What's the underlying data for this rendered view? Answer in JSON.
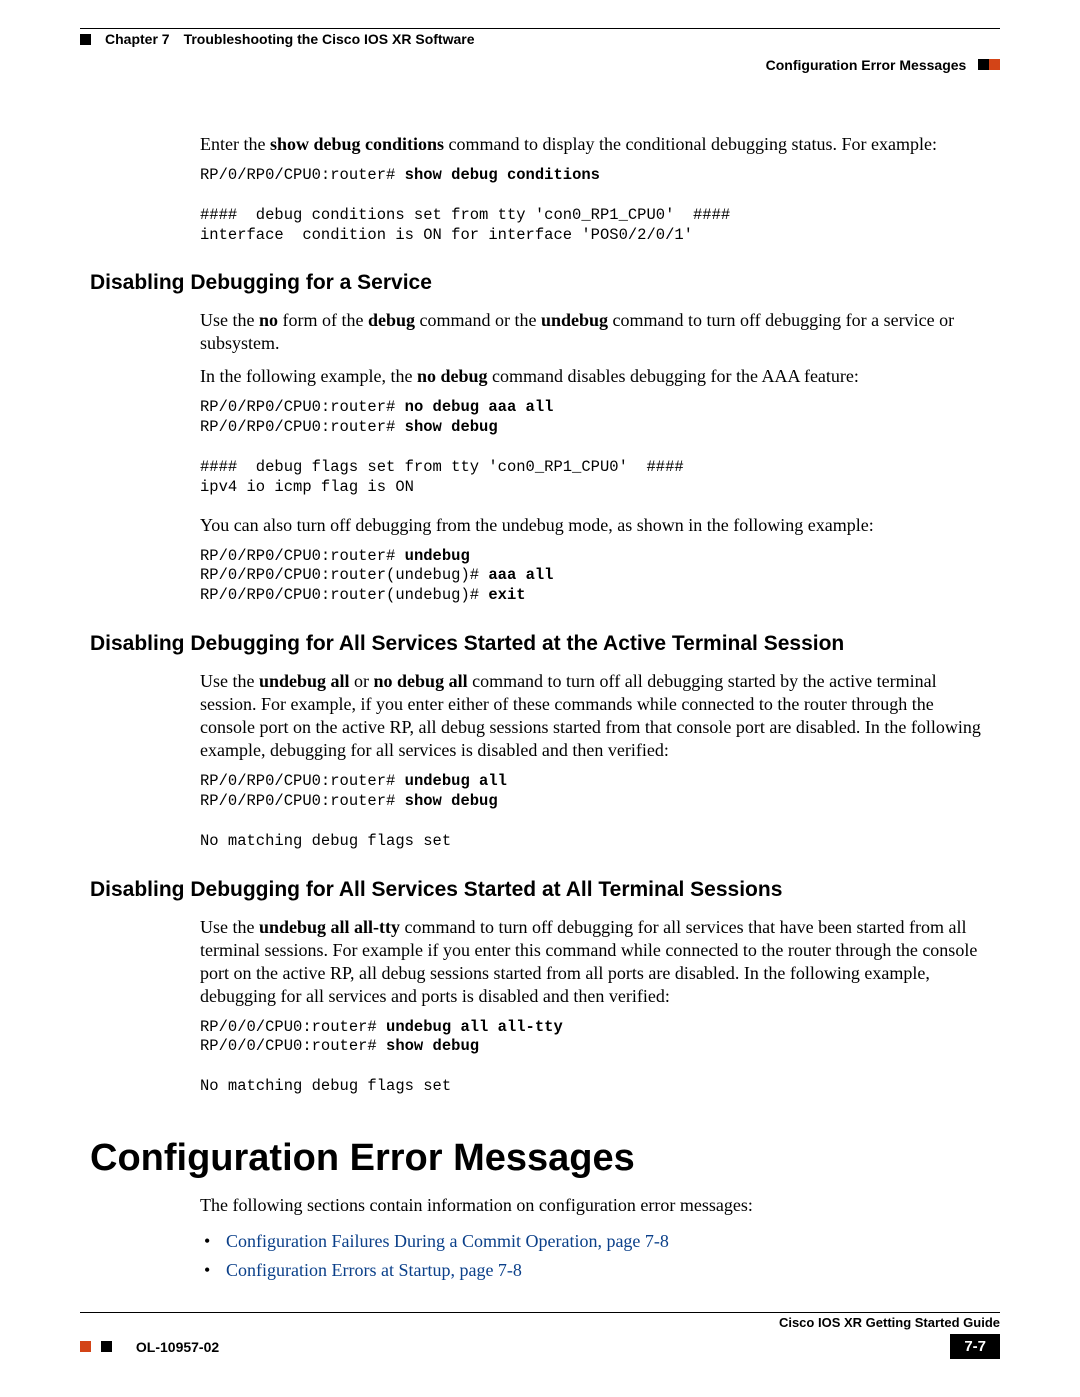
{
  "header": {
    "chapter_label": "Chapter 7",
    "chapter_title": "Troubleshooting the Cisco IOS XR Software",
    "section_label": "Configuration Error Messages"
  },
  "intro": {
    "pre": "Enter the ",
    "bold": "show debug conditions",
    "post": " command to display the conditional debugging status. For example:"
  },
  "code1": {
    "l1p": "RP/0/RP0/CPU0:router# ",
    "l1b": "show debug conditions",
    "l2": "",
    "l3": "####  debug conditions set from tty 'con0_RP1_CPU0'  ####",
    "l4": "interface  condition is ON for interface 'POS0/2/0/1'"
  },
  "s1": {
    "title": "Disabling Debugging for a Service",
    "p1_a": "Use the ",
    "p1_b_no": "no",
    "p1_c": " form of the ",
    "p1_b_debug": "debug",
    "p1_d": " command or the ",
    "p1_b_undebug": "undebug",
    "p1_e": " command to turn off debugging for a service or subsystem.",
    "p2_a": "In the following example, the ",
    "p2_b": "no debug",
    "p2_c": " command disables debugging for the AAA feature:",
    "code": {
      "l1p": "RP/0/RP0/CPU0:router# ",
      "l1b": "no debug aaa all",
      "l2p": "RP/0/RP0/CPU0:router# ",
      "l2b": "show debug",
      "l3": "",
      "l4": "####  debug flags set from tty 'con0_RP1_CPU0'  ####",
      "l5": "ipv4 io icmp flag is ON"
    },
    "p3": "You can also turn off debugging from the undebug mode, as shown in the following example:",
    "code2": {
      "l1p": "RP/0/RP0/CPU0:router# ",
      "l1b": "undebug",
      "l2p": "RP/0/RP0/CPU0:router(undebug)# ",
      "l2b": "aaa all",
      "l3p": "RP/0/RP0/CPU0:router(undebug)# ",
      "l3b": "exit"
    }
  },
  "s2": {
    "title": "Disabling Debugging for All Services Started at the Active Terminal Session",
    "p_a": "Use the ",
    "p_b1": "undebug all",
    "p_mid": " or ",
    "p_b2": "no debug all",
    "p_c": " command to turn off all debugging started by the active terminal session. For example, if you enter either of these commands while connected to the router through the console port on the active RP, all debug sessions started from that console port are disabled. In the following example, debugging for all services is disabled and then verified:",
    "code": {
      "l1p": "RP/0/RP0/CPU0:router# ",
      "l1b": "undebug all",
      "l2p": "RP/0/RP0/CPU0:router# ",
      "l2b": "show debug",
      "l3": "",
      "l4": "No matching debug flags set"
    }
  },
  "s3": {
    "title": "Disabling Debugging for All Services Started at All Terminal Sessions",
    "p_a": "Use the ",
    "p_b": "undebug all all-tty",
    "p_c": " command to turn off debugging for all services that have been started from all terminal sessions. For example if you enter this command while connected to the router through the console port on the active RP, all debug sessions started from all ports are disabled. In the following example, debugging for all services and ports is disabled and then verified:",
    "code": {
      "l1p": "RP/0/0/CPU0:router# ",
      "l1b": "undebug all all-tty",
      "l2p": "RP/0/0/CPU0:router# ",
      "l2b": "show debug",
      "l3": "",
      "l4": "No matching debug flags set"
    }
  },
  "major": {
    "title": "Configuration Error Messages",
    "intro": "The following sections contain information on configuration error messages:",
    "link1": "Configuration Failures During a Commit Operation, page 7-8",
    "link2": "Configuration Errors at Startup, page 7-8"
  },
  "footer": {
    "guide": "Cisco IOS XR Getting Started Guide",
    "doc": "OL-10957-02",
    "page": "7-7"
  }
}
